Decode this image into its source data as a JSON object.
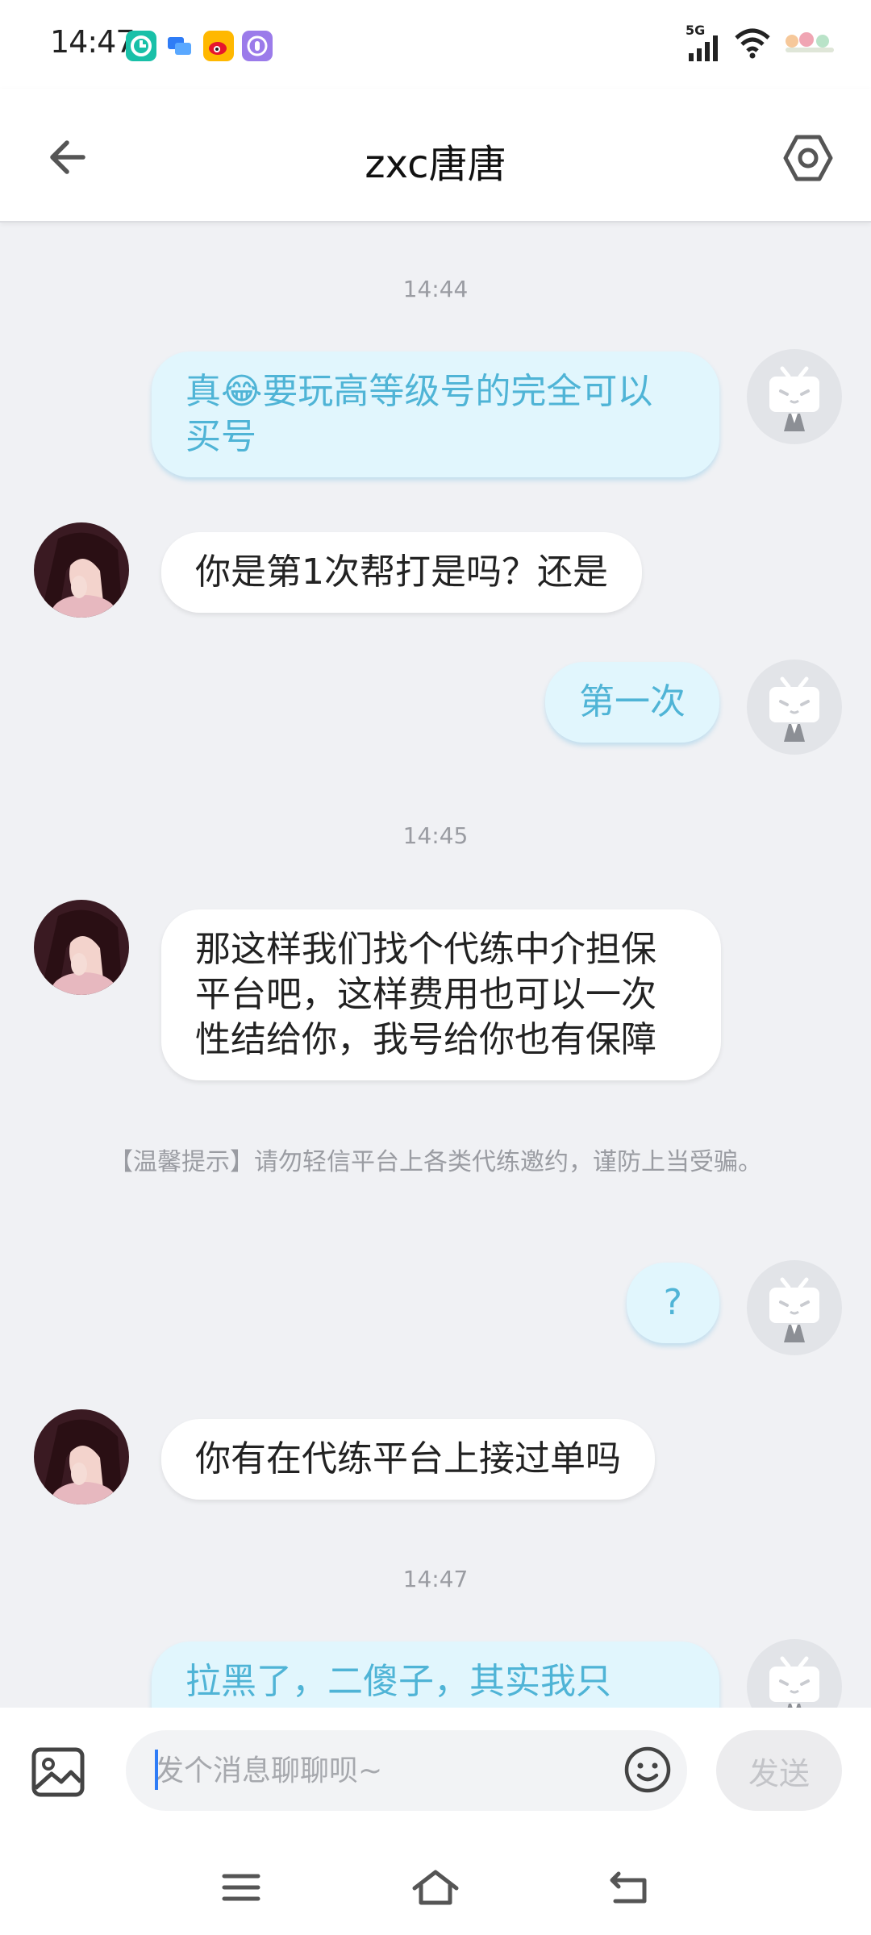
{
  "status_bar": {
    "time": "14:47",
    "network": "5G"
  },
  "header": {
    "title": "zxc唐唐"
  },
  "messages": [
    {
      "kind": "timestamp",
      "text": "14:44"
    },
    {
      "kind": "out",
      "text": "真😂要玩高等级号的完全可以买号"
    },
    {
      "kind": "in",
      "text": "你是第1次帮打是吗？还是"
    },
    {
      "kind": "out",
      "text": "第一次"
    },
    {
      "kind": "timestamp",
      "text": "14:45"
    },
    {
      "kind": "in",
      "text": "那这样我们找个代练中介担保平台吧，这样费用也可以一次性结给你，我号给你也有保障"
    },
    {
      "kind": "tip",
      "text": "【温馨提示】请勿轻信平台上各类代练邀约，谨防上当受骗。"
    },
    {
      "kind": "out",
      "text": "?"
    },
    {
      "kind": "in",
      "text": "你有在代练平台上接过单吗"
    },
    {
      "kind": "timestamp",
      "text": "14:47"
    },
    {
      "kind": "out",
      "text": "拉黑了，二傻子，其实我只"
    }
  ],
  "input": {
    "placeholder": "发个消息聊聊呗~",
    "value": "",
    "send_label": "发送"
  },
  "colors": {
    "out_bubble_bg": "#e1f6fd",
    "out_bubble_text": "#4fb4d6",
    "in_bubble_bg": "#ffffff",
    "chat_bg": "#f0f1f4"
  },
  "icons": {
    "back": "arrow-left-icon",
    "settings": "hexagon-settings-icon",
    "image": "image-icon",
    "emoji": "smiley-icon",
    "nav_menu": "menu-icon",
    "nav_home": "home-icon",
    "nav_back": "return-icon"
  }
}
